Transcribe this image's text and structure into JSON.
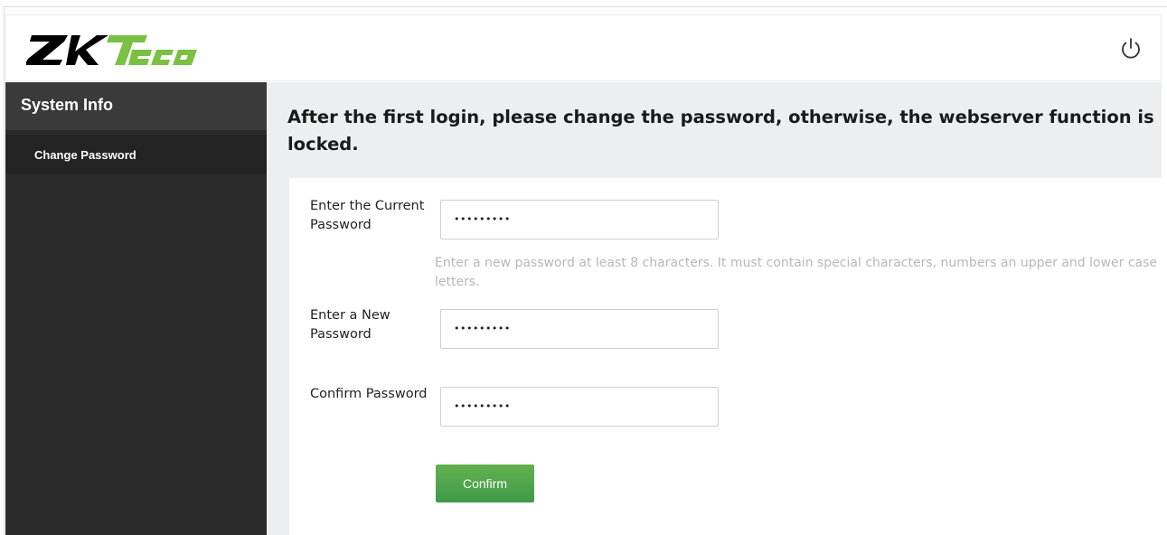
{
  "header": {
    "logo_text": "ZKTeco",
    "power_icon": "power-icon"
  },
  "sidebar": {
    "title": "System Info",
    "items": [
      {
        "label": "Change Password"
      }
    ]
  },
  "main": {
    "notice": "After the first login, please change the password, otherwise, the webserver function is locked.",
    "form": {
      "current_password_label": "Enter the Current Password",
      "current_password_value": "•••••••••",
      "hint": "Enter a new password at least 8 characters. It must contain special characters, numbers an upper and lower case letters.",
      "new_password_label": "Enter a New Password",
      "new_password_value": "•••••••••",
      "confirm_password_label": "Confirm Password",
      "confirm_password_value": "•••••••••",
      "confirm_button": "Confirm"
    }
  },
  "colors": {
    "sidebar_bg": "#2b2b2b",
    "sidebar_title_bg": "#3a3a3a",
    "main_bg": "#eceeef",
    "confirm_green": "#4ea54a",
    "hint_gray": "#b8b8b8"
  }
}
